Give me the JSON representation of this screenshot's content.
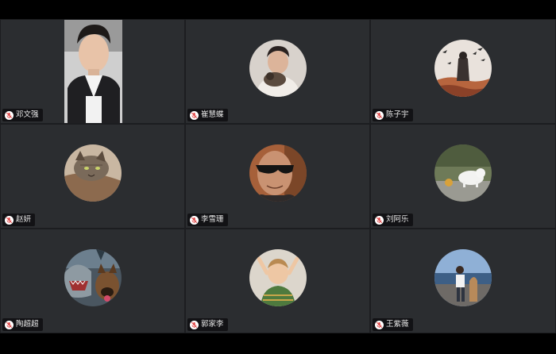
{
  "participants": [
    {
      "name": "邓文强",
      "mic": "mic-muted-icon",
      "media": "camera-video"
    },
    {
      "name": "崔慧蝶",
      "mic": "mic-muted-icon",
      "media": "avatar"
    },
    {
      "name": "陈子宇",
      "mic": "mic-muted-icon",
      "media": "avatar"
    },
    {
      "name": "赵妍",
      "mic": "mic-muted-icon",
      "media": "avatar"
    },
    {
      "name": "李雪珊",
      "mic": "mic-muted-icon",
      "media": "avatar"
    },
    {
      "name": "刘阿乐",
      "mic": "mic-muted-icon",
      "media": "avatar"
    },
    {
      "name": "陶超超",
      "mic": "mic-muted-icon",
      "media": "avatar"
    },
    {
      "name": "郭家李",
      "mic": "mic-muted-icon",
      "media": "avatar"
    },
    {
      "name": "王紫薇",
      "mic": "mic-muted-icon",
      "media": "avatar"
    }
  ],
  "colors": {
    "tile_background": "#2b2d30",
    "mic_muted": "#e04848"
  }
}
